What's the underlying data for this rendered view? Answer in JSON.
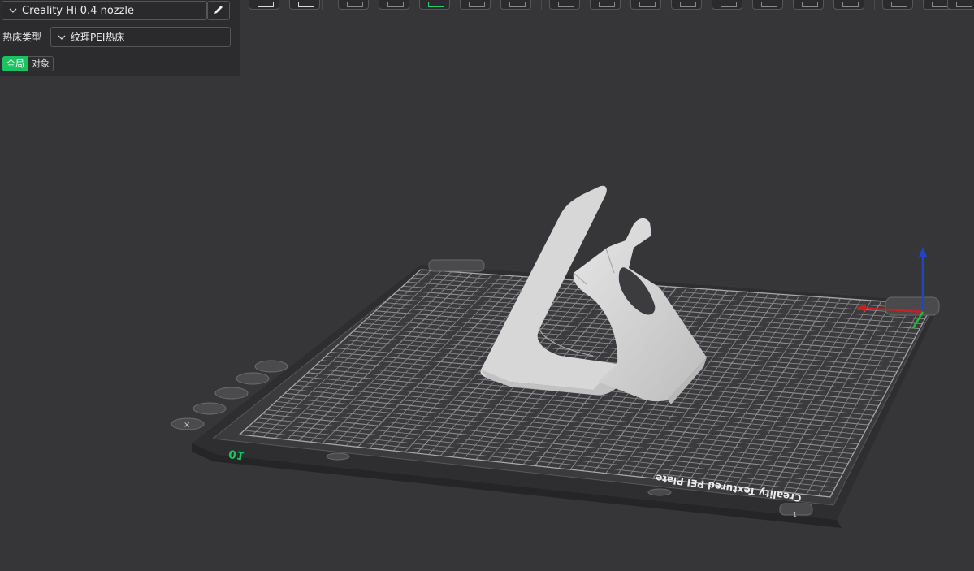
{
  "panel": {
    "printer": "Creality Hi 0.4 nozzle",
    "bed_type_label": "热床类型",
    "bed_type_value": "纹理PEI热床",
    "tabs": [
      {
        "label": "全局",
        "active": true
      },
      {
        "label": "对象",
        "active": false
      }
    ]
  },
  "toolbar": {
    "buttons": [
      "add-object-icon",
      "plate-icon",
      "orient-icon",
      "arrange-icon",
      "auto-orient-icon",
      "layout-icon",
      "split-icon",
      "cut-icon",
      "move-icon",
      "rotate-icon",
      "scale-icon",
      "support-paint-icon",
      "seam-paint-icon",
      "text-icon",
      "measure-icon",
      "assembly-icon",
      "layers-icon",
      "variable-height-icon"
    ]
  },
  "viewport": {
    "plate_label": "Creality Textured PEI Plate",
    "plate_number": "01",
    "plate_corner_number": "1",
    "model": "phone-stand",
    "colors": {
      "background": "#363638",
      "bed": "#3b3b3d",
      "grid": "#8e8e90",
      "model": "#d4d4d4",
      "accent": "#1ec15f"
    }
  }
}
